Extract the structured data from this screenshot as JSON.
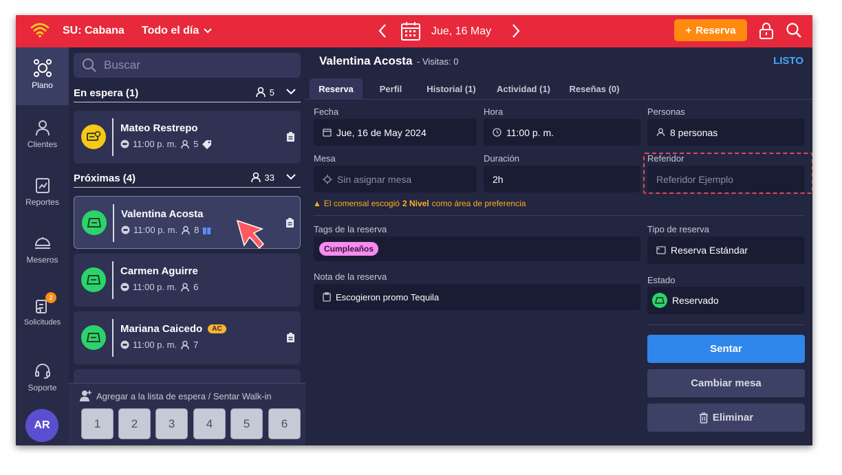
{
  "topbar": {
    "venue": "SU: Cabana",
    "shift": "Todo el día",
    "date": "Jue, 16 May",
    "reserve_label": "Reserva",
    "icons": [
      "wifi-icon",
      "chevron-down-icon",
      "chevron-left-icon",
      "calendar-icon",
      "chevron-right-icon",
      "lock-icon",
      "search-icon"
    ]
  },
  "sidebar": {
    "items": [
      {
        "label": "Plano",
        "icon": "floor-plan-icon",
        "active": true
      },
      {
        "label": "Clientes",
        "icon": "user-icon"
      },
      {
        "label": "Reportes",
        "icon": "chart-icon"
      },
      {
        "label": "Meseros",
        "icon": "waiter-icon"
      },
      {
        "label": "Solicitudes",
        "icon": "requests-icon",
        "badge": "2"
      },
      {
        "label": "Soporte",
        "icon": "headset-icon"
      }
    ],
    "avatar": "AR"
  },
  "list": {
    "search_placeholder": "Buscar",
    "waiting": {
      "title": "En espera (1)",
      "count": "5"
    },
    "upcoming": {
      "title": "Próximas (4)",
      "count": "33"
    },
    "cards": [
      {
        "name": "Mateo Restrepo",
        "time": "11:00 p. m.",
        "guests": "5",
        "status_color": "#f5c915"
      },
      {
        "name": "Valentina Acosta",
        "time": "11:00 p. m.",
        "guests": "8",
        "status_color": "#2bd46a"
      },
      {
        "name": "Carmen Aguirre",
        "time": "11:00 p. m.",
        "guests": "6",
        "status_color": "#2bd46a"
      },
      {
        "name": "Mariana Caicedo",
        "badge": "AC",
        "time": "11:00 p. m.",
        "guests": "7",
        "status_color": "#2bd46a"
      }
    ],
    "waitlist_link": "Agregar a la lista de espera / Sentar Walk-in",
    "party_sizes": [
      "1",
      "2",
      "3",
      "4",
      "5",
      "6"
    ]
  },
  "detail": {
    "name": "Valentina Acosta",
    "visits": "- Visitas: 0",
    "done_label": "LISTO",
    "tabs": [
      "Reserva",
      "Perfil",
      "Historial (1)",
      "Actividad (1)",
      "Reseñas (0)"
    ],
    "fields": {
      "date_label": "Fecha",
      "date": "Jue, 16 de May 2024",
      "time_label": "Hora",
      "time": "11:00 p. m.",
      "people_label": "Personas",
      "people": "8 personas",
      "table_label": "Mesa",
      "table": "Sin asignar mesa",
      "duration_label": "Duración",
      "duration": "2h",
      "referrer_label": "Referidor",
      "referrer_placeholder": "Referidor Ejemplo"
    },
    "preference": {
      "before": "El comensal escogió",
      "area": "2 Nivel",
      "after": "como área de preferencia"
    },
    "tags_label": "Tags de la reserva",
    "tags": [
      "Cumpleaños"
    ],
    "type_label": "Tipo de reserva",
    "type": "Reserva Estándar",
    "note_label": "Nota de la reserva",
    "note": "Escogieron promo Tequila",
    "status_label": "Estado",
    "status": "Reservado",
    "buttons": {
      "seat": "Sentar",
      "change_table": "Cambiar mesa",
      "delete": "Eliminar"
    },
    "colors": {
      "seat": "#2f86eb",
      "secondary": "#3e4166",
      "accent": "#e8293b",
      "orange": "#ff8a10"
    }
  }
}
